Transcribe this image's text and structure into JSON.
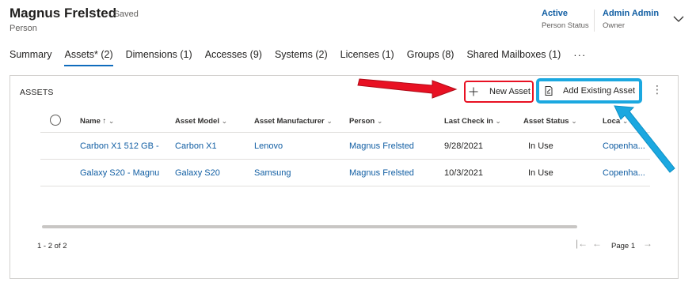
{
  "header": {
    "title": "Magnus Frelsted",
    "saved_status": "- Saved",
    "entity_type": "Person",
    "fields": [
      {
        "value": "Active",
        "label": "Person Status"
      },
      {
        "value": "Admin Admin",
        "label": "Owner"
      }
    ],
    "expand_icon": "chevron-down-icon"
  },
  "tabs": [
    {
      "label": "Summary"
    },
    {
      "label": "Assets* (2)",
      "active": true
    },
    {
      "label": "Dimensions (1)"
    },
    {
      "label": "Accesses (9)"
    },
    {
      "label": "Systems (2)"
    },
    {
      "label": "Licenses (1)"
    },
    {
      "label": "Groups (8)"
    },
    {
      "label": "Shared Mailboxes (1)"
    }
  ],
  "tabs_more": "···",
  "assets": {
    "title": "ASSETS",
    "new_button": "New Asset",
    "add_existing_button": "Add Existing Asset",
    "more": "⋮",
    "columns": [
      {
        "label": "Name",
        "sort": "↑"
      },
      {
        "label": "Asset Model"
      },
      {
        "label": "Asset Manufacturer"
      },
      {
        "label": "Person"
      },
      {
        "label": "Last Check in"
      },
      {
        "label": "Asset Status"
      },
      {
        "label": "Loca"
      }
    ],
    "rows": [
      {
        "name": "Carbon X1 512 GB -",
        "model": "Carbon X1",
        "manufacturer": "Lenovo",
        "person": "Magnus Frelsted",
        "last_check_in": "9/28/2021",
        "status": "In Use",
        "location": "Copenha..."
      },
      {
        "name": "Galaxy S20 - Magnu",
        "model": "Galaxy S20",
        "manufacturer": "Samsung",
        "person": "Magnus Frelsted",
        "last_check_in": "10/3/2021",
        "status": "In Use",
        "location": "Copenha..."
      }
    ],
    "record_count": "1 - 2 of 2",
    "page_label": "Page 1"
  },
  "annotation_colors": {
    "red": "#e81123",
    "blue": "#1ba8e0"
  }
}
